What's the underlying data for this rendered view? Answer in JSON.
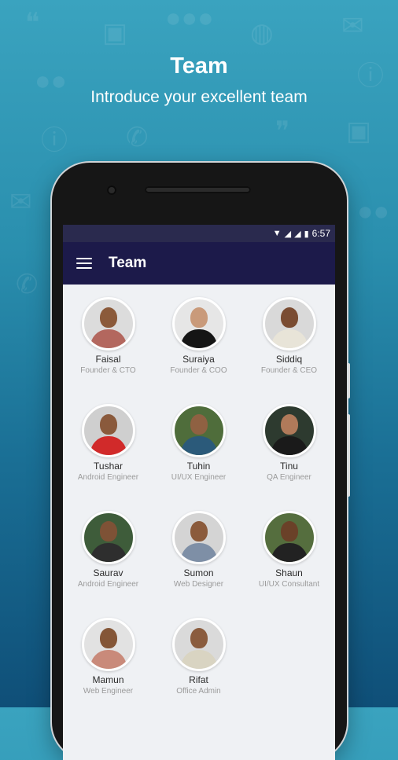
{
  "promo": {
    "title": "Team",
    "subtitle": "Introduce your excellent team"
  },
  "status": {
    "time": "6:57"
  },
  "appbar": {
    "title": "Team"
  },
  "members": [
    {
      "name": "Faisal",
      "role": "Founder & CTO",
      "bg": "#dcdcdc",
      "skin": "#8b5a3a",
      "shirt": "#b3675e"
    },
    {
      "name": "Suraiya",
      "role": "Founder & COO",
      "bg": "#e6e6e6",
      "skin": "#c99a7a",
      "shirt": "#151515"
    },
    {
      "name": "Siddiq",
      "role": "Founder & CEO",
      "bg": "#d9d9d9",
      "skin": "#7a4c32",
      "shirt": "#e8e4d8"
    },
    {
      "name": "Tushar",
      "role": "Android Engineer",
      "bg": "#cfcfcf",
      "skin": "#8a5a3c",
      "shirt": "#d12a2a"
    },
    {
      "name": "Tuhin",
      "role": "UI/UX Engineer",
      "bg": "#4f6d3b",
      "skin": "#8f6142",
      "shirt": "#2b5a7a"
    },
    {
      "name": "Tinu",
      "role": "QA Engineer",
      "bg": "#2d3a2f",
      "skin": "#b07a5a",
      "shirt": "#1a1a1a"
    },
    {
      "name": "Saurav",
      "role": "Android Engineer",
      "bg": "#3e5c3a",
      "skin": "#7e5236",
      "shirt": "#2e2e2e"
    },
    {
      "name": "Sumon",
      "role": "Web Designer",
      "bg": "#d4d4d4",
      "skin": "#8b5b3c",
      "shirt": "#7e8fa6"
    },
    {
      "name": "Shaun",
      "role": "UI/UX Consultant",
      "bg": "#556e3e",
      "skin": "#6a4128",
      "shirt": "#222222"
    },
    {
      "name": "Mamun",
      "role": "Web Engineer",
      "bg": "#e2e2e2",
      "skin": "#845637",
      "shirt": "#c98a7a"
    },
    {
      "name": "Rifat",
      "role": "Office Admin",
      "bg": "#dadada",
      "skin": "#8a5c3e",
      "shirt": "#d9d4c2"
    }
  ]
}
